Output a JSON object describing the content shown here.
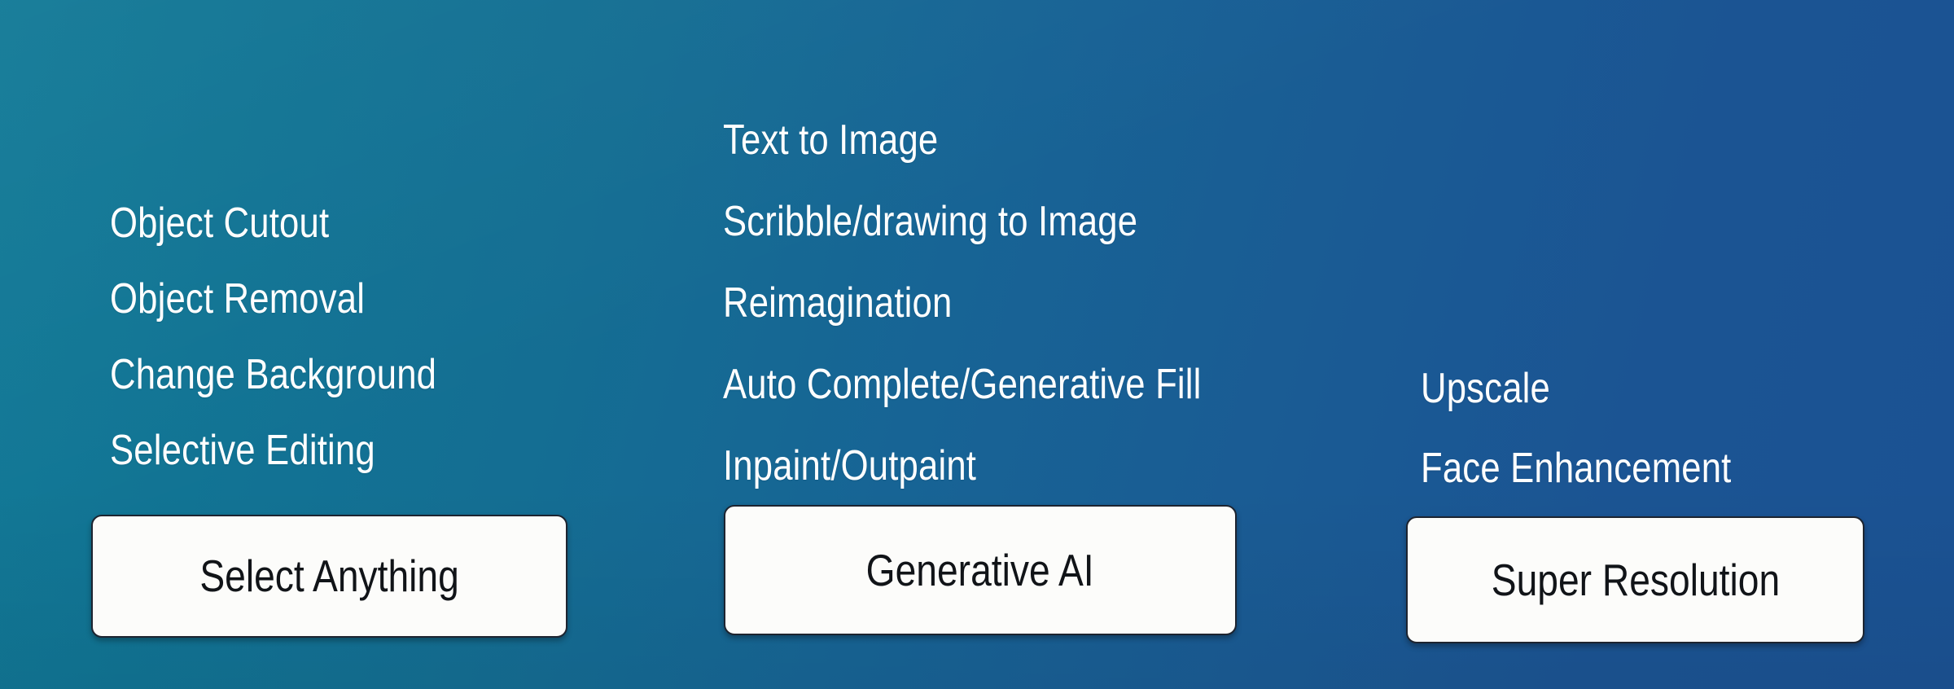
{
  "background": {
    "gradient_start": "#127a97",
    "gradient_end": "#1b5293",
    "direction": "left-to-right diagonal"
  },
  "text_color": "#ffffff",
  "button_style": {
    "fill": "#fcfcfa",
    "border": "#1d2430",
    "label_color": "#111418"
  },
  "groups": [
    {
      "id": "select-anything",
      "button_label": "Select Anything",
      "features": [
        "Object Cutout",
        "Object Removal",
        "Change Background",
        "Selective Editing"
      ]
    },
    {
      "id": "generative-ai",
      "button_label": "Generative AI",
      "features": [
        "Text to Image",
        "Scribble/drawing to Image",
        "Reimagination",
        "Auto Complete/Generative Fill",
        "Inpaint/Outpaint"
      ]
    },
    {
      "id": "super-resolution",
      "button_label": "Super Resolution",
      "features": [
        "Upscale",
        "Face Enhancement"
      ]
    }
  ]
}
